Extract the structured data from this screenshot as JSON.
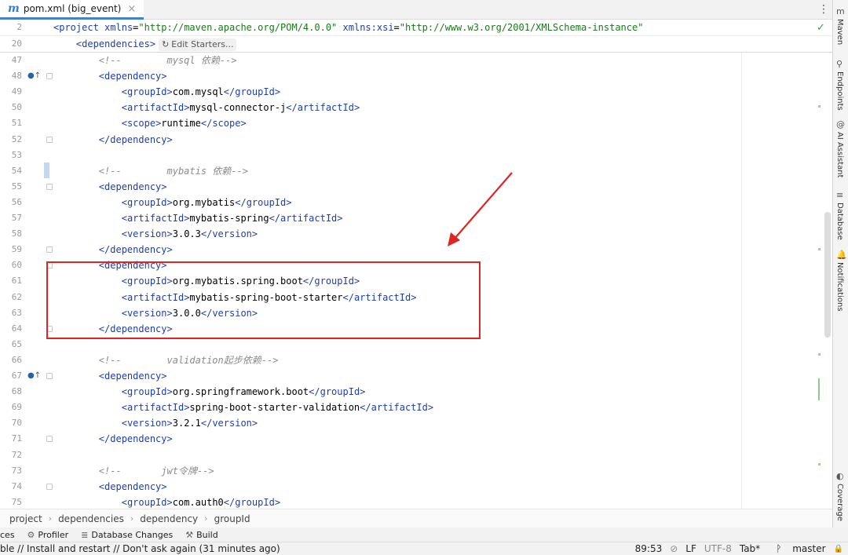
{
  "tab": {
    "icon": "maven-m-icon",
    "title": "pom.xml (big_event)",
    "close": "×"
  },
  "tab_menu": "⋮",
  "sticky": {
    "line1": {
      "ln": "2",
      "open": "<",
      "tag": "project",
      "sp1": " ",
      "attr1": "xmlns",
      "eq1": "=",
      "val1": "\"http://maven.apache.org/POM/4.0.0\"",
      "sp2": " ",
      "attr2": "xmlns:xsi",
      "eq2": "=",
      "val2": "\"http://www.w3.org/2001/XMLSchema-instance\""
    },
    "line2": {
      "ln": "20",
      "indent": "    ",
      "open": "<",
      "tag": "dependencies",
      "close": ">",
      "edit_starters": "Edit Starters..."
    }
  },
  "lines": [
    {
      "ln": "47",
      "kind": "comment",
      "indent": "        ",
      "text": "<!--        mysql 依赖-->"
    },
    {
      "ln": "48",
      "kind": "open",
      "indent": "        ",
      "tag": "dependency",
      "mark": "●↑"
    },
    {
      "ln": "49",
      "kind": "elem",
      "indent": "            ",
      "tag": "groupId",
      "value": "com.mysql"
    },
    {
      "ln": "50",
      "kind": "elem",
      "indent": "            ",
      "tag": "artifactId",
      "value": "mysql-connector-j"
    },
    {
      "ln": "51",
      "kind": "elem",
      "indent": "            ",
      "tag": "scope",
      "value": "runtime"
    },
    {
      "ln": "52",
      "kind": "close",
      "indent": "        ",
      "tag": "dependency"
    },
    {
      "ln": "53",
      "kind": "blank"
    },
    {
      "ln": "54",
      "kind": "comment",
      "indent": "        ",
      "text": "<!--        mybatis 依赖-->"
    },
    {
      "ln": "55",
      "kind": "open",
      "indent": "        ",
      "tag": "dependency"
    },
    {
      "ln": "56",
      "kind": "elem",
      "indent": "            ",
      "tag": "groupId",
      "value": "org.mybatis"
    },
    {
      "ln": "57",
      "kind": "elem",
      "indent": "            ",
      "tag": "artifactId",
      "value": "mybatis-spring"
    },
    {
      "ln": "58",
      "kind": "elem",
      "indent": "            ",
      "tag": "version",
      "value": "3.0.3"
    },
    {
      "ln": "59",
      "kind": "close",
      "indent": "        ",
      "tag": "dependency"
    },
    {
      "ln": "60",
      "kind": "open",
      "indent": "        ",
      "tag": "dependency"
    },
    {
      "ln": "61",
      "kind": "elem",
      "indent": "            ",
      "tag": "groupId",
      "value": "org.mybatis.spring.boot"
    },
    {
      "ln": "62",
      "kind": "elem",
      "indent": "            ",
      "tag": "artifactId",
      "value": "mybatis-spring-boot-starter"
    },
    {
      "ln": "63",
      "kind": "elem",
      "indent": "            ",
      "tag": "version",
      "value": "3.0.0"
    },
    {
      "ln": "64",
      "kind": "close",
      "indent": "        ",
      "tag": "dependency"
    },
    {
      "ln": "65",
      "kind": "blank"
    },
    {
      "ln": "66",
      "kind": "comment",
      "indent": "        ",
      "text": "<!--        validation起步依赖-->"
    },
    {
      "ln": "67",
      "kind": "open",
      "indent": "        ",
      "tag": "dependency",
      "mark": "●↑"
    },
    {
      "ln": "68",
      "kind": "elem",
      "indent": "            ",
      "tag": "groupId",
      "value": "org.springframework.boot"
    },
    {
      "ln": "69",
      "kind": "elem",
      "indent": "            ",
      "tag": "artifactId",
      "value": "spring-boot-starter-validation"
    },
    {
      "ln": "70",
      "kind": "elem",
      "indent": "            ",
      "tag": "version",
      "value": "3.2.1"
    },
    {
      "ln": "71",
      "kind": "close",
      "indent": "        ",
      "tag": "dependency"
    },
    {
      "ln": "72",
      "kind": "blank"
    },
    {
      "ln": "73",
      "kind": "comment",
      "indent": "        ",
      "text": "<!--       jwt令牌-->"
    },
    {
      "ln": "74",
      "kind": "open",
      "indent": "        ",
      "tag": "dependency"
    },
    {
      "ln": "75",
      "kind": "elem",
      "indent": "            ",
      "tag": "groupId",
      "value": "com.auth0"
    }
  ],
  "right_tools": [
    {
      "icon": "maven-icon",
      "glyph": "m",
      "label": "Maven"
    },
    {
      "icon": "endpoints-icon",
      "glyph": "⚲",
      "label": "Endpoints"
    },
    {
      "icon": "ai-assistant-icon",
      "glyph": "@",
      "label": "AI Assistant"
    },
    {
      "icon": "database-icon",
      "glyph": "≡",
      "label": "Database"
    },
    {
      "icon": "notifications-icon",
      "glyph": "🔔",
      "label": "Notifications"
    },
    {
      "icon": "coverage-icon",
      "glyph": "◐",
      "label": "Coverage"
    }
  ],
  "breadcrumb": [
    "project",
    "dependencies",
    "dependency",
    "groupId"
  ],
  "breadcrumb_sep": "›",
  "tool_windows": [
    {
      "icon": "services-icon",
      "glyph": "",
      "label": "ces"
    },
    {
      "icon": "profiler-icon",
      "glyph": "⚙",
      "label": "Profiler"
    },
    {
      "icon": "database-changes-icon",
      "glyph": "≣",
      "label": "Database Changes"
    },
    {
      "icon": "build-icon",
      "glyph": "⚒",
      "label": "Build"
    }
  ],
  "status": {
    "message": "ble // Install and restart // Don't ask again (31 minutes ago)",
    "position": "89:53",
    "no_inspections_glyph": "⊘",
    "line_sep": "LF",
    "encoding": "UTF-8",
    "indent": "Tab*",
    "branch_glyph": "ᚹ",
    "branch": "master",
    "lock_glyph": "🔒"
  },
  "edit_starters_icon": "↻",
  "check": "✓",
  "colors": {
    "tag": "#1f3fa8",
    "string": "#1a7a1a",
    "comment": "#8c8c8c",
    "highlight": "#e02323",
    "tab_accent": "#4083c9"
  }
}
